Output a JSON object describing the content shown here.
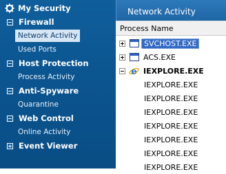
{
  "sidebar": {
    "my_security": "My Security",
    "firewall": "Firewall",
    "network_activity": "Network Activity",
    "used_ports": "Used Ports",
    "host_protection": "Host Protection",
    "process_activity": "Process Activity",
    "anti_spyware": "Anti-Spyware",
    "quarantine": "Quarantine",
    "web_control": "Web Control",
    "online_activity": "Online Activity",
    "event_viewer": "Event Viewer"
  },
  "panel": {
    "title": "Network Activity",
    "column_header": "Process Name"
  },
  "processes": [
    {
      "name": "SVCHOST.EXE",
      "state": "collapsed",
      "selected": true
    },
    {
      "name": "ACS.EXE",
      "state": "collapsed"
    },
    {
      "name": "IEXPLORE.EXE",
      "state": "expanded",
      "bold": true
    },
    {
      "name": "IEXPLORE.EXE"
    },
    {
      "name": "IEXPLORE.EXE"
    },
    {
      "name": "IEXPLORE.EXE"
    },
    {
      "name": "IEXPLORE.EXE"
    },
    {
      "name": "IEXPLORE.EXE"
    },
    {
      "name": "IEXPLORE.EXE"
    },
    {
      "name": "IEXPLORE.EXE"
    }
  ],
  "colors": {
    "sidebar_bg": "#0b5590",
    "selection": "#316ac5",
    "selected_nav_bg": "#d7e6f5"
  }
}
